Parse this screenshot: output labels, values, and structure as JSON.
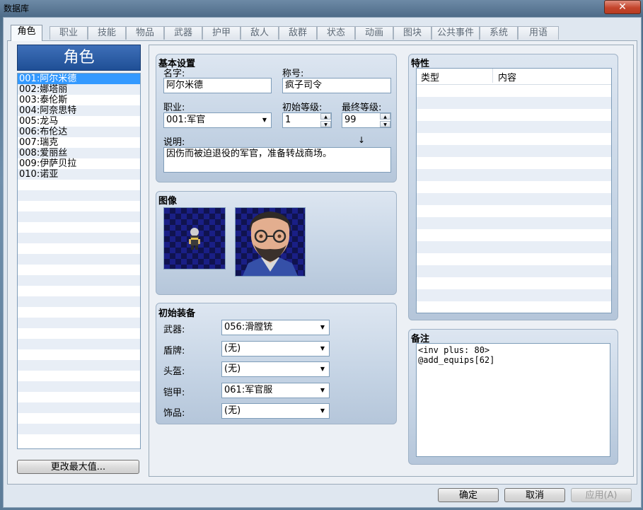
{
  "window": {
    "title": "数据库",
    "close_glyph": "✕"
  },
  "tabs": [
    "角色",
    "职业",
    "技能",
    "物品",
    "武器",
    "护甲",
    "敌人",
    "敌群",
    "状态",
    "动画",
    "图块",
    "公共事件",
    "系统",
    "用语"
  ],
  "actor_list": {
    "header": "角色",
    "items": [
      "001:阿尔米德",
      "002:娜塔丽",
      "003:泰伦斯",
      "004:阿奈思特",
      "005:龙马",
      "006:布伦达",
      "007:瑞克",
      "008:爱丽丝",
      "009:伊萨贝拉",
      "010:诺亚"
    ],
    "selected_index": 0,
    "change_max_button": "更改最大值..."
  },
  "basic": {
    "title": "基本设置",
    "name_label": "名字:",
    "name_value": "阿尔米德",
    "nickname_label": "称号:",
    "nickname_value": "疯子司令",
    "class_label": "职业:",
    "class_value": "001:军官",
    "initial_level_label": "初始等级:",
    "initial_level_value": "1",
    "max_level_label": "最终等级:",
    "max_level_value": "99",
    "description_label": "说明:",
    "description_value": "因伤而被迫退役的军官，准备转战商场。",
    "cursor_glyph": "↓"
  },
  "images": {
    "title": "图像"
  },
  "equipment": {
    "title": "初始装备",
    "slots": [
      {
        "label": "武器:",
        "value": "056:滑膛铳"
      },
      {
        "label": "盾牌:",
        "value": "(无)"
      },
      {
        "label": "头盔:",
        "value": "(无)"
      },
      {
        "label": "铠甲:",
        "value": "061:军官服"
      },
      {
        "label": "饰品:",
        "value": "(无)"
      }
    ]
  },
  "traits": {
    "title": "特性",
    "col_type": "类型",
    "col_content": "内容"
  },
  "note": {
    "title": "备注",
    "lines": [
      "<inv plus: 80>",
      "@add_equips[62]"
    ]
  },
  "footer": {
    "ok": "确定",
    "cancel": "取消",
    "apply": "应用(A)"
  },
  "colors": {
    "accent": "#3399ff",
    "header_blue": "#1f4f96"
  }
}
